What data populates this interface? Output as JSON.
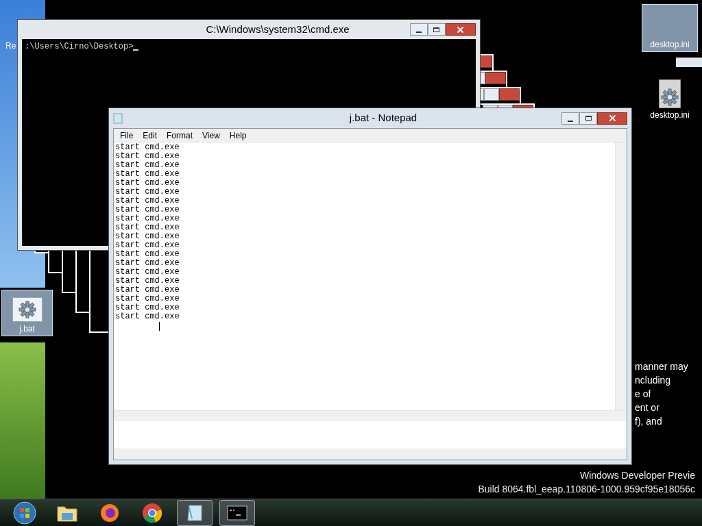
{
  "desktop_icons": [
    {
      "kind": "batch",
      "label": "j.bat",
      "selected": true
    },
    {
      "kind": "blank",
      "label": "desktop.ini",
      "selected": true
    },
    {
      "kind": "settings-file",
      "label": "desktop.ini",
      "selected": false
    }
  ],
  "desktop_fragment": "Re",
  "cmd_window": {
    "title": "C:\\Windows\\system32\\cmd.exe",
    "prompt": ":\\Users\\Cirno\\Desktop>"
  },
  "notepad": {
    "title": "j.bat - Notepad",
    "menu": [
      "File",
      "Edit",
      "Format",
      "View",
      "Help"
    ],
    "lines": [
      "start cmd.exe",
      "start cmd.exe",
      "start cmd.exe",
      "start cmd.exe",
      "start cmd.exe",
      "start cmd.exe",
      "start cmd.exe",
      "start cmd.exe",
      "start cmd.exe",
      "start cmd.exe",
      "start cmd.exe",
      "start cmd.exe",
      "start cmd.exe",
      "start cmd.exe",
      "start cmd.exe",
      "start cmd.exe",
      "start cmd.exe",
      "start cmd.exe",
      "start cmd.exe",
      "start cmd.exe"
    ]
  },
  "background_text": [
    "manner may",
    "ncluding",
    "e of",
    "ent or",
    "f), and"
  ],
  "build_watermark": [
    "Windows Developer Previe",
    "Build 8064.fbl_eeap.110806-1000.959cf95e18056c"
  ],
  "taskbar": [
    {
      "kind": "start",
      "running": false
    },
    {
      "kind": "explorer",
      "running": false
    },
    {
      "kind": "firefox",
      "running": false
    },
    {
      "kind": "chrome",
      "running": false
    },
    {
      "kind": "notepad",
      "running": true
    },
    {
      "kind": "cmd",
      "running": true
    }
  ]
}
